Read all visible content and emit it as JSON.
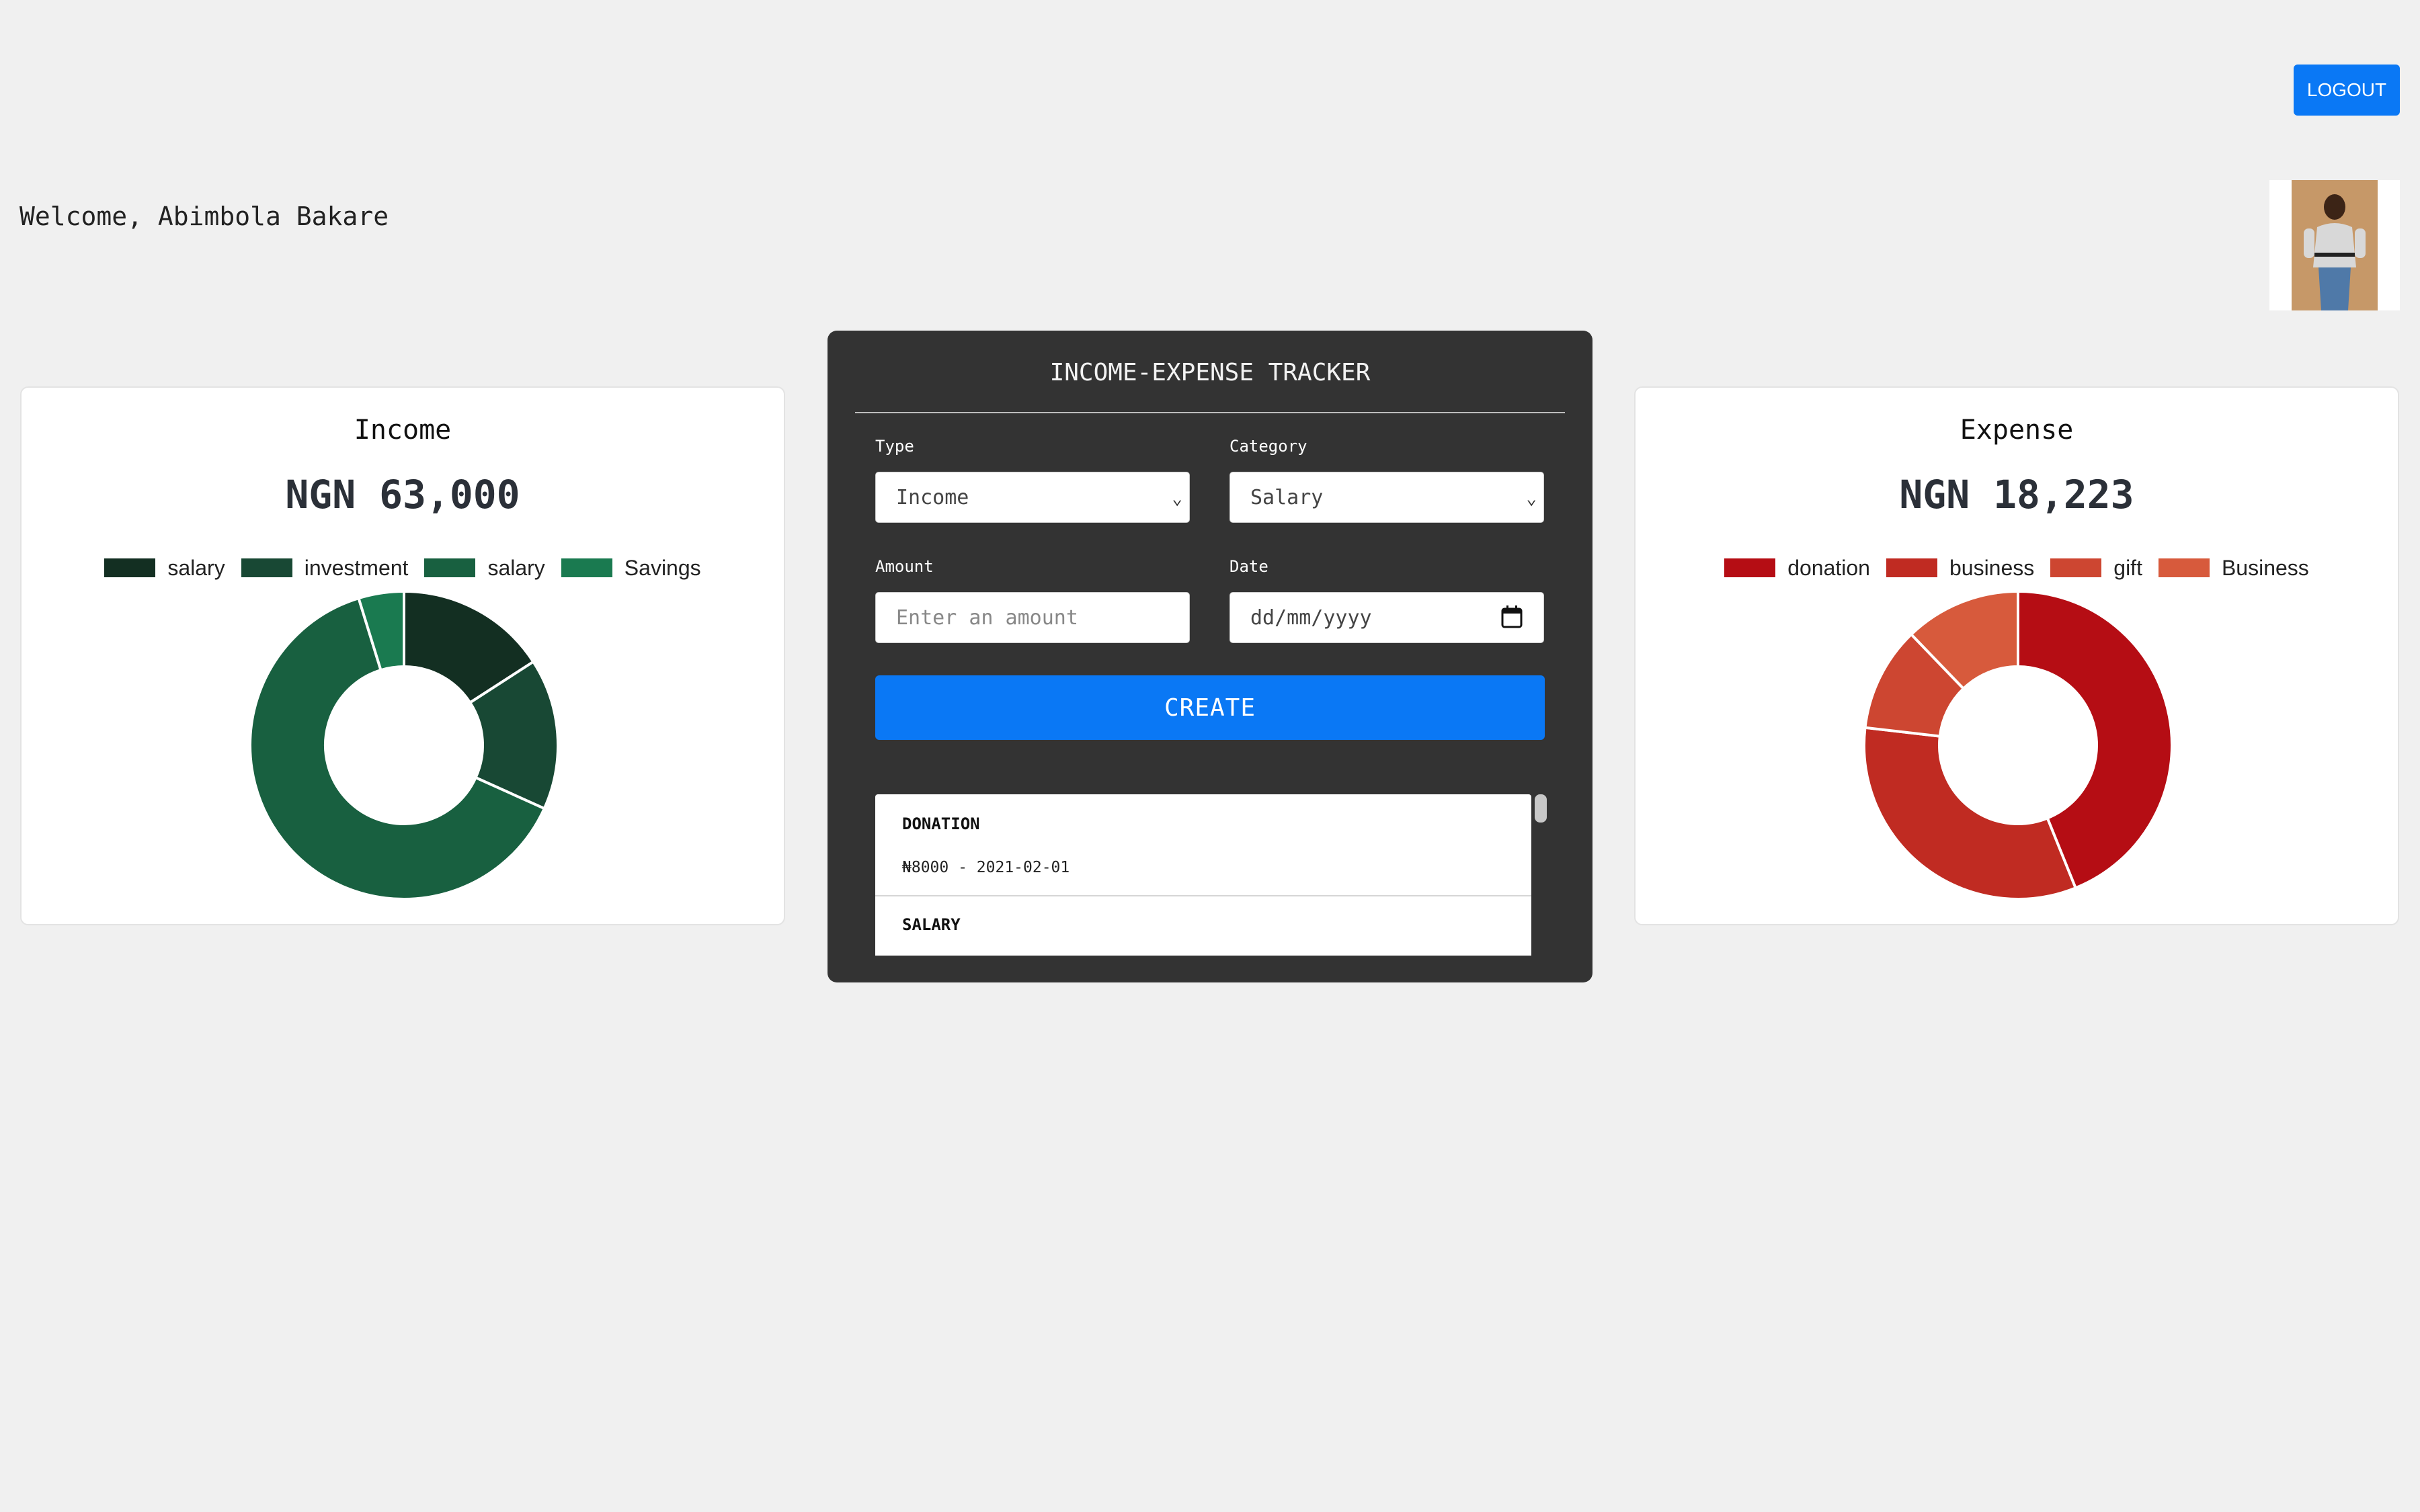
{
  "header": {
    "logout_label": "LOGOUT",
    "welcome_text": "Welcome, Abimbola Bakare"
  },
  "income_card": {
    "title": "Income",
    "total": "NGN 63,000",
    "legend": [
      "salary",
      "investment",
      "salary",
      "Savings"
    ]
  },
  "expense_card": {
    "title": "Expense",
    "total": "NGN 18,223",
    "legend": [
      "donation",
      "business",
      "gift",
      "Business"
    ]
  },
  "tracker": {
    "title": "INCOME-EXPENSE TRACKER",
    "type_label": "Type",
    "type_value": "Income",
    "category_label": "Category",
    "category_value": "Salary",
    "amount_label": "Amount",
    "amount_placeholder": "Enter an amount",
    "date_label": "Date",
    "date_placeholder": "dd/mm/yyyy",
    "create_label": "CREATE",
    "transactions": [
      {
        "title": "DONATION",
        "detail": "₦8000 - 2021-02-01"
      },
      {
        "title": "SALARY",
        "detail": ""
      }
    ]
  },
  "chart_data": [
    {
      "type": "pie",
      "categories": [
        "salary",
        "investment",
        "salary",
        "Savings"
      ],
      "values": [
        10000,
        10000,
        40000,
        3000
      ],
      "colors": [
        "#132f22",
        "#184834",
        "#186040",
        "#1a7a50"
      ],
      "legend": "top"
    },
    {
      "type": "pie",
      "categories": [
        "donation",
        "business",
        "gift",
        "Business"
      ],
      "values": [
        8000,
        6000,
        2000,
        2223
      ],
      "colors": [
        "#b50d14",
        "#c02b22",
        "#cd4631",
        "#d75a3c"
      ],
      "legend": "top"
    }
  ]
}
